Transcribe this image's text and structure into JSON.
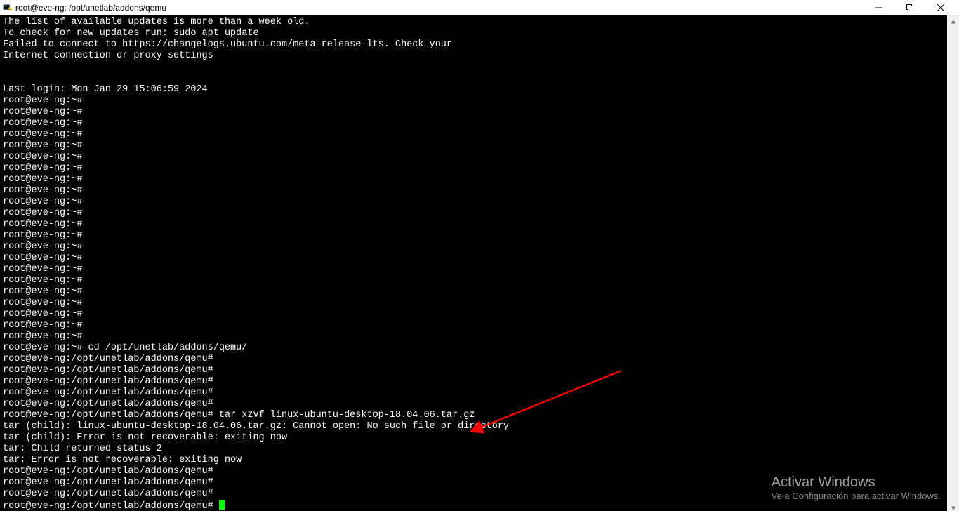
{
  "window": {
    "title": "root@eve-ng: /opt/unetlab/addons/qemu"
  },
  "terminal": {
    "lines": [
      "The list of available updates is more than a week old.",
      "To check for new updates run: sudo apt update",
      "Failed to connect to https://changelogs.ubuntu.com/meta-release-lts. Check your",
      "Internet connection or proxy settings",
      "",
      "",
      "Last login: Mon Jan 29 15:06:59 2024",
      "root@eve-ng:~#",
      "root@eve-ng:~#",
      "root@eve-ng:~#",
      "root@eve-ng:~#",
      "root@eve-ng:~#",
      "root@eve-ng:~#",
      "root@eve-ng:~#",
      "root@eve-ng:~#",
      "root@eve-ng:~#",
      "root@eve-ng:~#",
      "root@eve-ng:~#",
      "root@eve-ng:~#",
      "root@eve-ng:~#",
      "root@eve-ng:~#",
      "root@eve-ng:~#",
      "root@eve-ng:~#",
      "root@eve-ng:~#",
      "root@eve-ng:~#",
      "root@eve-ng:~#",
      "root@eve-ng:~#",
      "root@eve-ng:~#",
      "root@eve-ng:~#",
      "root@eve-ng:~# cd /opt/unetlab/addons/qemu/",
      "root@eve-ng:/opt/unetlab/addons/qemu#",
      "root@eve-ng:/opt/unetlab/addons/qemu#",
      "root@eve-ng:/opt/unetlab/addons/qemu#",
      "root@eve-ng:/opt/unetlab/addons/qemu#",
      "root@eve-ng:/opt/unetlab/addons/qemu#",
      "root@eve-ng:/opt/unetlab/addons/qemu# tar xzvf linux-ubuntu-desktop-18.04.06.tar.gz",
      "tar (child): linux-ubuntu-desktop-18.04.06.tar.gz: Cannot open: No such file or directory",
      "tar (child): Error is not recoverable: exiting now",
      "tar: Child returned status 2",
      "tar: Error is not recoverable: exiting now",
      "root@eve-ng:/opt/unetlab/addons/qemu#",
      "root@eve-ng:/opt/unetlab/addons/qemu#",
      "root@eve-ng:/opt/unetlab/addons/qemu#",
      "root@eve-ng:/opt/unetlab/addons/qemu# "
    ]
  },
  "watermark": {
    "title": "Activar Windows",
    "subtitle": "Ve a Configuración para activar Windows."
  },
  "annotation": {
    "arrow_color": "#ff0000"
  }
}
